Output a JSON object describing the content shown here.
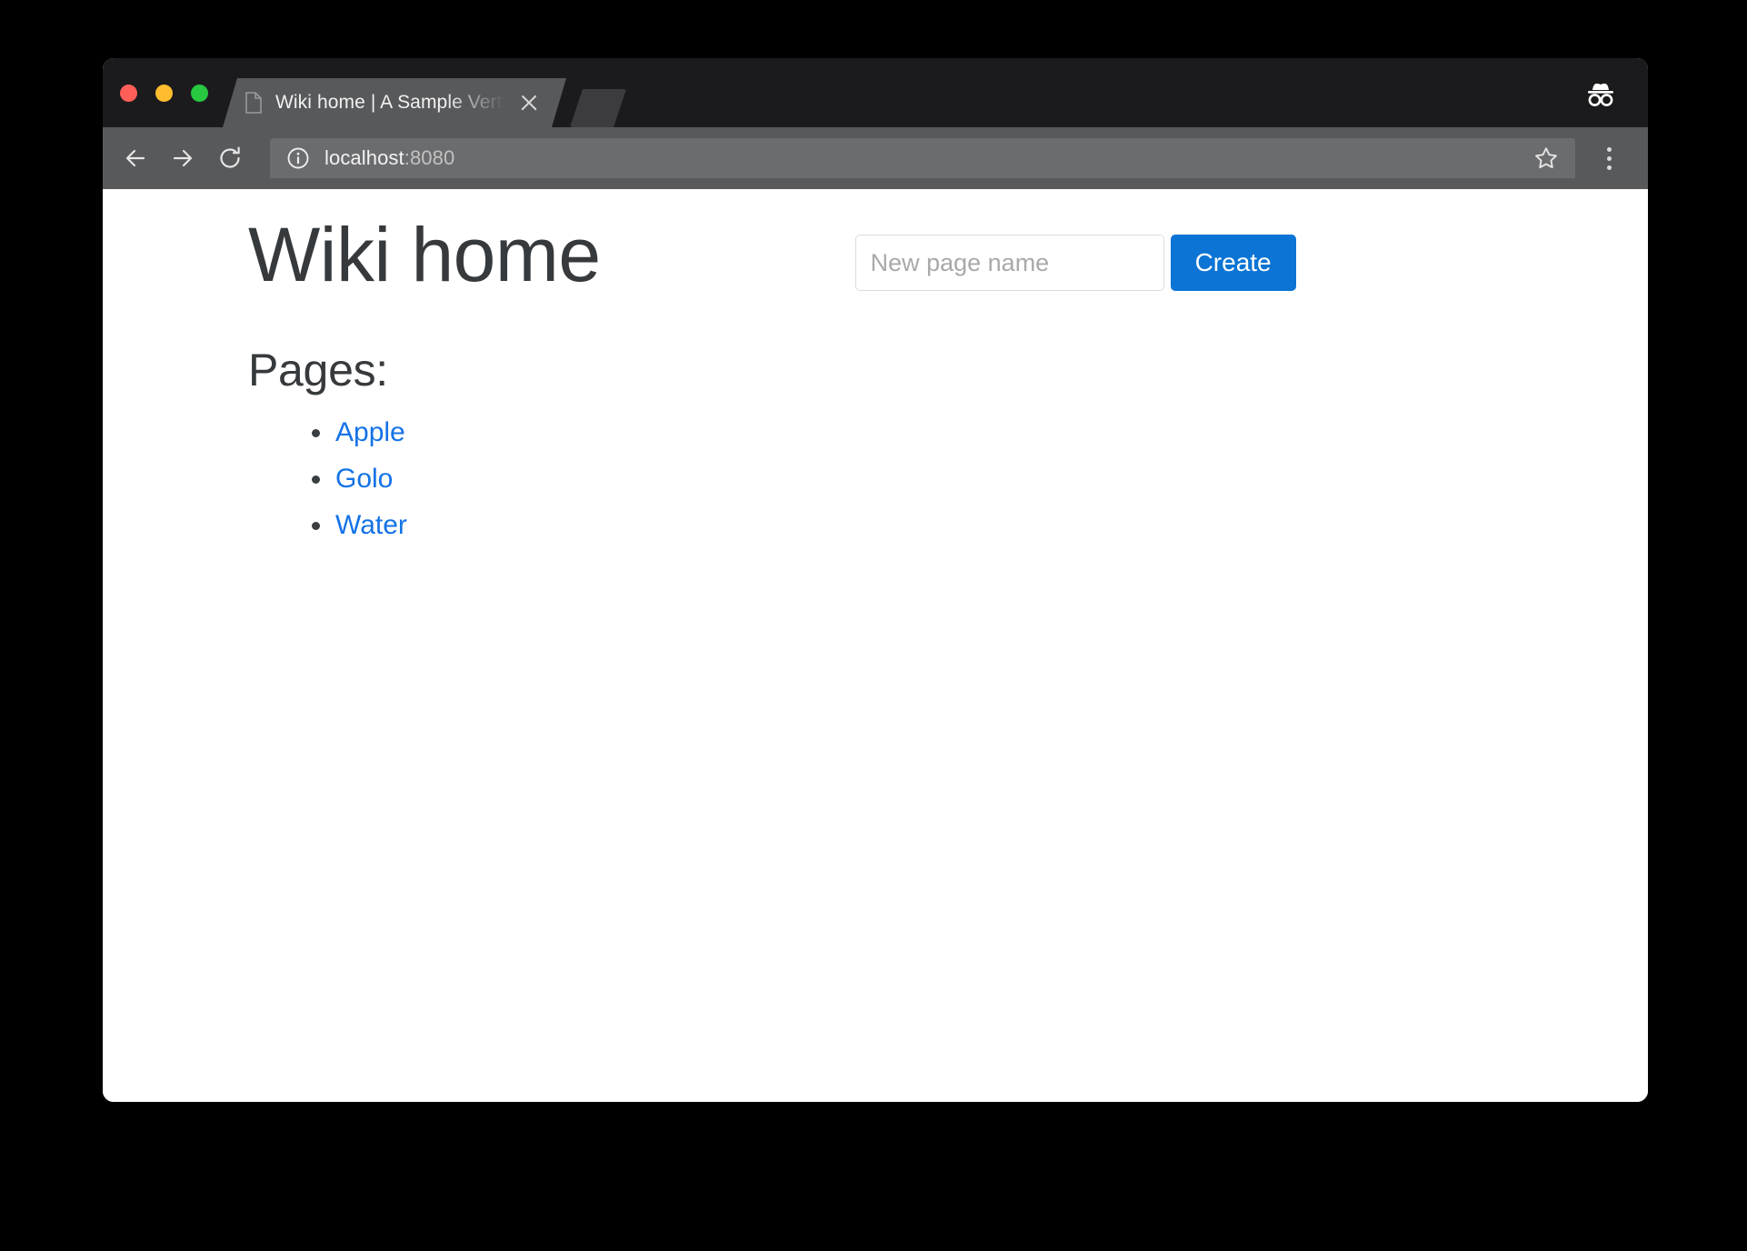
{
  "browser": {
    "window_controls": [
      {
        "name": "close",
        "color": "#ff5f57"
      },
      {
        "name": "minimize",
        "color": "#febc2e"
      },
      {
        "name": "maximize",
        "color": "#28c840"
      }
    ],
    "tab": {
      "title": "Wiki home | A Sample Vert.x-powered Wiki",
      "favicon_icon": "document-icon",
      "close_icon": "close-icon"
    },
    "new_tab_icon": "new-tab-button",
    "incognito_icon": "incognito-icon",
    "nav": {
      "back_icon": "back-arrow-icon",
      "forward_icon": "forward-arrow-icon",
      "reload_icon": "reload-icon"
    },
    "omnibox": {
      "info_icon": "info-circle-icon",
      "host": "localhost",
      "port": ":8080",
      "star_icon": "star-icon",
      "menu_icon": "three-dot-menu-icon"
    }
  },
  "page": {
    "title": "Wiki home",
    "create_form": {
      "input_placeholder": "New page name",
      "input_value": "",
      "submit_label": "Create"
    },
    "pages_heading": "Pages:",
    "pages": [
      {
        "label": "Apple"
      },
      {
        "label": "Golo"
      },
      {
        "label": "Water"
      }
    ]
  },
  "colors": {
    "link": "#1472e6",
    "button": "#0b74d4",
    "text": "#373a3c",
    "tabstrip": "#1b1b1d",
    "toolbar": "#58595b"
  }
}
